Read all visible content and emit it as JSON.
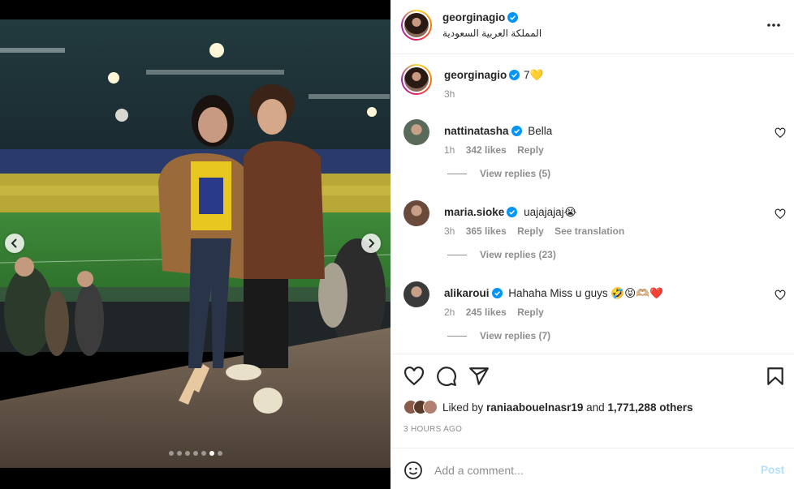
{
  "post": {
    "username": "georginagio",
    "location": "المملكة العربية السعودية",
    "caption": "7💛",
    "caption_time": "3h",
    "slides": {
      "count": 7,
      "active": 5
    }
  },
  "comments": [
    {
      "username": "nattinatasha",
      "text": "Bella",
      "time": "1h",
      "likes": "342 likes",
      "reply": "Reply",
      "translation": "",
      "view_replies": "View replies (5)",
      "avatar_color": "#5a6a5a"
    },
    {
      "username": "maria.sioke",
      "text": "uajajajaj😭",
      "time": "3h",
      "likes": "365 likes",
      "reply": "Reply",
      "translation": "See translation",
      "view_replies": "View replies (23)",
      "avatar_color": "#6a4a3a"
    },
    {
      "username": "alikaroui",
      "text": "Hahaha Miss u guys 🤣😝🫶🏼❤️",
      "time": "2h",
      "likes": "245 likes",
      "reply": "Reply",
      "translation": "",
      "view_replies": "View replies (7)",
      "avatar_color": "#3a3a3a"
    }
  ],
  "likes": {
    "prefix": "Liked by ",
    "user": "raniaabouelnasr19",
    "conj": " and ",
    "others": "1,771,288 others"
  },
  "post_time": "3 HOURS AGO",
  "add_comment": {
    "placeholder": "Add a comment...",
    "post_label": "Post"
  }
}
